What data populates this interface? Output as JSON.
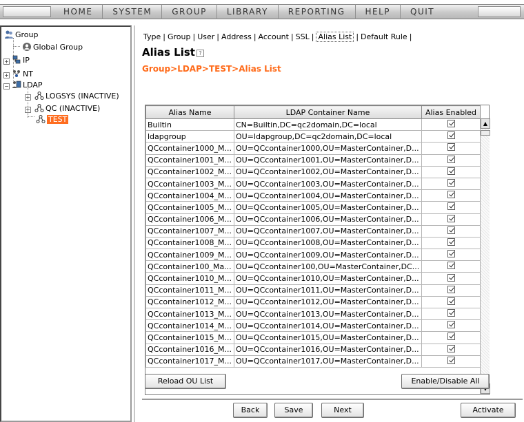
{
  "menu": [
    "HOME",
    "SYSTEM",
    "GROUP",
    "LIBRARY",
    "REPORTING",
    "HELP",
    "QUIT"
  ],
  "tree": {
    "root": "Group",
    "global": "Global Group",
    "ip": "IP",
    "nt": "NT",
    "ldap": "LDAP",
    "logsys": "LOGSYS (INACTIVE)",
    "qc": "QC (INACTIVE)",
    "test": "TEST"
  },
  "tabs": [
    "Type",
    "Group",
    "User",
    "Address",
    "Account",
    "SSL",
    "Alias List",
    "Default Rule"
  ],
  "active_tab": "Alias List",
  "title": "Alias List",
  "breadcrumb": "Group>LDAP>TEST>Alias List",
  "table": {
    "headers": [
      "Alias Name",
      "LDAP Container Name",
      "Alias Enabled"
    ],
    "rows": [
      [
        "Builtin",
        "CN=Builtin,DC=qc2domain,DC=local"
      ],
      [
        "ldapgroup",
        "OU=ldapgroup,DC=qc2domain,DC=local"
      ],
      [
        "QCcontainer1000_M...",
        "OU=QCcontainer1000,OU=MasterContainer,D..."
      ],
      [
        "QCcontainer1001_M...",
        "OU=QCcontainer1001,OU=MasterContainer,D..."
      ],
      [
        "QCcontainer1002_M...",
        "OU=QCcontainer1002,OU=MasterContainer,D..."
      ],
      [
        "QCcontainer1003_M...",
        "OU=QCcontainer1003,OU=MasterContainer,D..."
      ],
      [
        "QCcontainer1004_M...",
        "OU=QCcontainer1004,OU=MasterContainer,D..."
      ],
      [
        "QCcontainer1005_M...",
        "OU=QCcontainer1005,OU=MasterContainer,D..."
      ],
      [
        "QCcontainer1006_M...",
        "OU=QCcontainer1006,OU=MasterContainer,D..."
      ],
      [
        "QCcontainer1007_M...",
        "OU=QCcontainer1007,OU=MasterContainer,D..."
      ],
      [
        "QCcontainer1008_M...",
        "OU=QCcontainer1008,OU=MasterContainer,D..."
      ],
      [
        "QCcontainer1009_M...",
        "OU=QCcontainer1009,OU=MasterContainer,D..."
      ],
      [
        "QCcontainer100_Ma...",
        "OU=QCcontainer100,OU=MasterContainer,DC..."
      ],
      [
        "QCcontainer1010_M...",
        "OU=QCcontainer1010,OU=MasterContainer,D..."
      ],
      [
        "QCcontainer1011_M...",
        "OU=QCcontainer1011,OU=MasterContainer,D..."
      ],
      [
        "QCcontainer1012_M...",
        "OU=QCcontainer1012,OU=MasterContainer,D..."
      ],
      [
        "QCcontainer1013_M...",
        "OU=QCcontainer1013,OU=MasterContainer,D..."
      ],
      [
        "QCcontainer1014_M...",
        "OU=QCcontainer1014,OU=MasterContainer,D..."
      ],
      [
        "QCcontainer1015_M...",
        "OU=QCcontainer1015,OU=MasterContainer,D..."
      ],
      [
        "QCcontainer1016_M...",
        "OU=QCcontainer1016,OU=MasterContainer,D..."
      ],
      [
        "QCcontainer1017_M...",
        "OU=QCcontainer1017,OU=MasterContainer,D..."
      ]
    ]
  },
  "buttons": {
    "reload": "Reload OU List",
    "enable_all": "Enable/Disable All",
    "back": "Back",
    "save": "Save",
    "next": "Next",
    "activate": "Activate"
  },
  "icons": {
    "group": "group-icon",
    "global": "global-group-icon",
    "network": "network-icon",
    "ldap": "ldap-icon",
    "container": "container-icon",
    "help": "help-icon",
    "checkbox": "checkbox-checked-icon"
  },
  "colors": {
    "accent": "#ff6b1a",
    "selected_bg": "#ff6d1f"
  }
}
